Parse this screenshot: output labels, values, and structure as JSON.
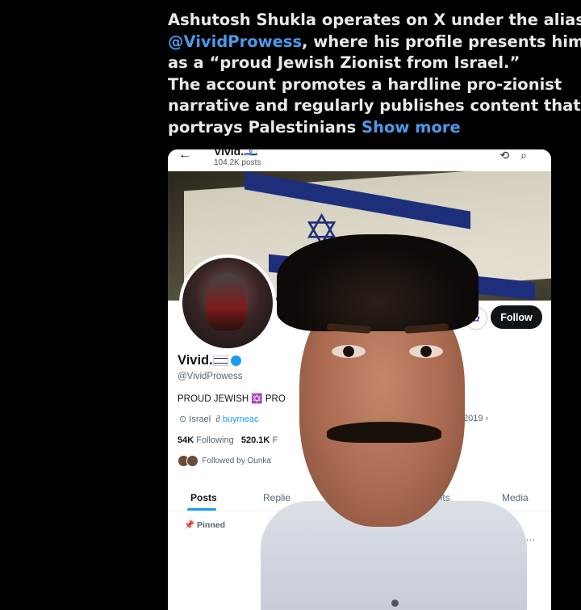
{
  "tweet": {
    "line1": "Ashutosh Shukla operates on X under the alias",
    "mention": "@VividProwess",
    "line2_rest": ", where his profile presents him",
    "line3": "as a “proud Jewish Zionist from Israel.”",
    "line4": "The account promotes a hardline pro-zionist",
    "line5": "narrative and regularly publishes content that",
    "line6": "portrays Palestinians",
    "show_more": "Show more"
  },
  "profile": {
    "header_title": "Vivid.🇮🇱",
    "post_count": "104.2K posts",
    "display_name": "Vivid.",
    "username": "@VividProwess",
    "bio": "PROUD JEWISH ✡️ PRO",
    "location": "Israel",
    "link": "buymeac",
    "joined": "2019 ›",
    "following_count": "54K",
    "following_label": "Following",
    "followers_count": "520.1K",
    "followers_label": "F",
    "followed_by": "Followed by Ounka",
    "follow_button": "Follow",
    "pinned_label": "Pinned"
  },
  "tabs": [
    "Posts",
    "Replie",
    "hlights",
    "Media"
  ],
  "icons": {
    "back": "arrow-left-icon",
    "retweet": "repeat-icon",
    "search": "search-icon",
    "more": "ellipsis-icon"
  },
  "colors": {
    "accent": "#1d9bf0",
    "mention": "#4c9ae8"
  }
}
